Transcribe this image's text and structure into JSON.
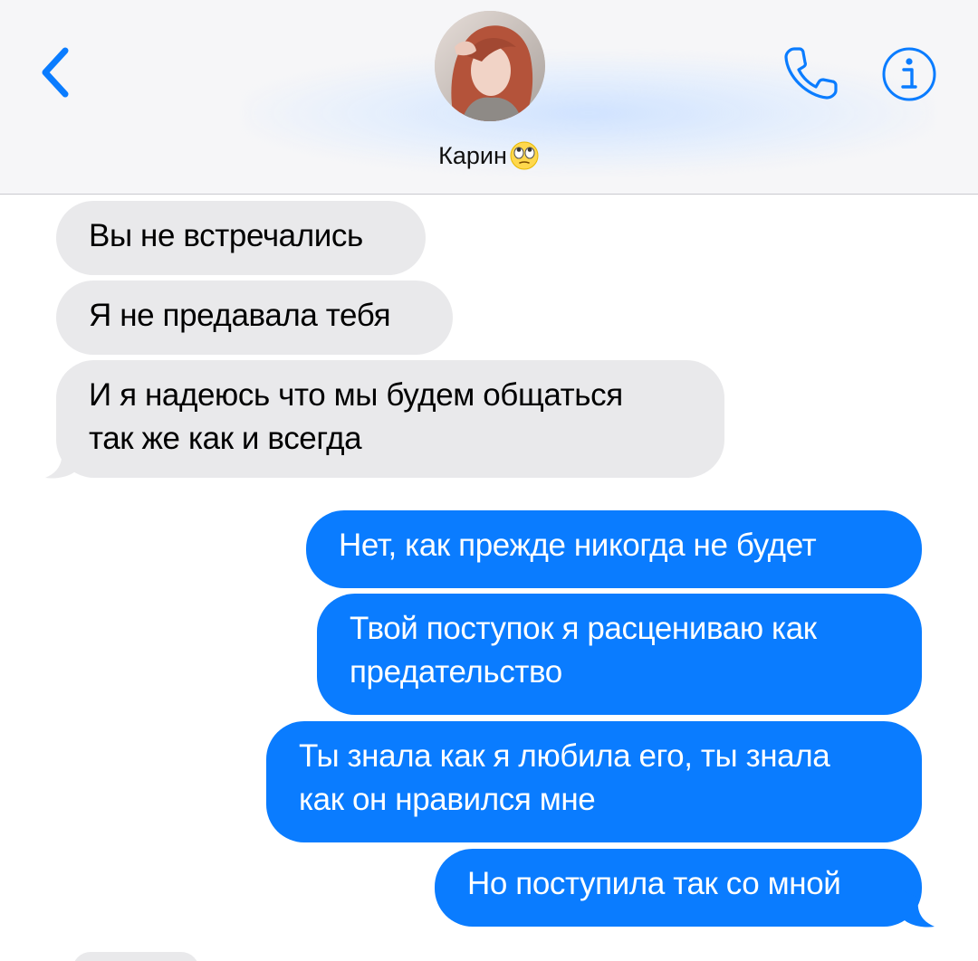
{
  "header": {
    "back_icon": "chevron-left-icon",
    "contact_name": "Карин",
    "contact_emoji": "eye-roll-emoji",
    "call_icon": "phone-icon",
    "info_icon": "info-icon",
    "accent_color": "#0a7cff"
  },
  "messages": [
    {
      "direction": "incoming",
      "text": "Вы не встречались"
    },
    {
      "direction": "incoming",
      "text": "Я не предавала тебя"
    },
    {
      "direction": "incoming",
      "lines": [
        "И я надеюсь что мы будем общаться",
        "так же как и всегда"
      ]
    },
    {
      "direction": "outgoing",
      "text": "Нет, как прежде никогда не будет"
    },
    {
      "direction": "outgoing",
      "lines": [
        "Твой поступок я расцениваю как",
        "предательство"
      ]
    },
    {
      "direction": "outgoing",
      "lines": [
        "Ты знала как я любила его, ты знала",
        "как он нравился мне"
      ]
    },
    {
      "direction": "outgoing",
      "text": "Но поступила так со мной"
    }
  ],
  "colors": {
    "incoming_bubble": "#e9e9eb",
    "outgoing_bubble": "#0a7cff",
    "header_bg": "#f6f6f8"
  }
}
